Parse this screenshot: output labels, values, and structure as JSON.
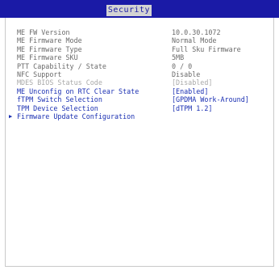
{
  "header": {
    "active_tab": "Security"
  },
  "rows": [
    {
      "label": "ME FW Version",
      "value": "10.0.30.1072",
      "style": "static"
    },
    {
      "label": "ME Firmware Mode",
      "value": "Normal Mode",
      "style": "static"
    },
    {
      "label": "ME Firmware Type",
      "value": "Full Sku Firmware",
      "style": "static"
    },
    {
      "label": "ME Firmware SKU",
      "value": "5MB",
      "style": "static"
    },
    {
      "label": "PTT Capability / State",
      "value": "0 / 0",
      "style": "static"
    },
    {
      "label": "NFC Support",
      "value": "Disable",
      "style": "static"
    },
    {
      "label": "MDES BIOS Status Code",
      "value": "[Disabled]",
      "style": "dim"
    },
    {
      "label": "ME Unconfig on RTC Clear State",
      "value": "[Enabled]",
      "style": "selectable"
    },
    {
      "label": "fTPM Switch Selection",
      "value": "[GPDMA Work-Around]",
      "style": "selectable"
    },
    {
      "label": "TPM Device Selection",
      "value": "[dTPM 1.2]",
      "style": "selectable"
    },
    {
      "label": "Firmware Update Configuration",
      "value": "",
      "style": "submenu"
    }
  ]
}
